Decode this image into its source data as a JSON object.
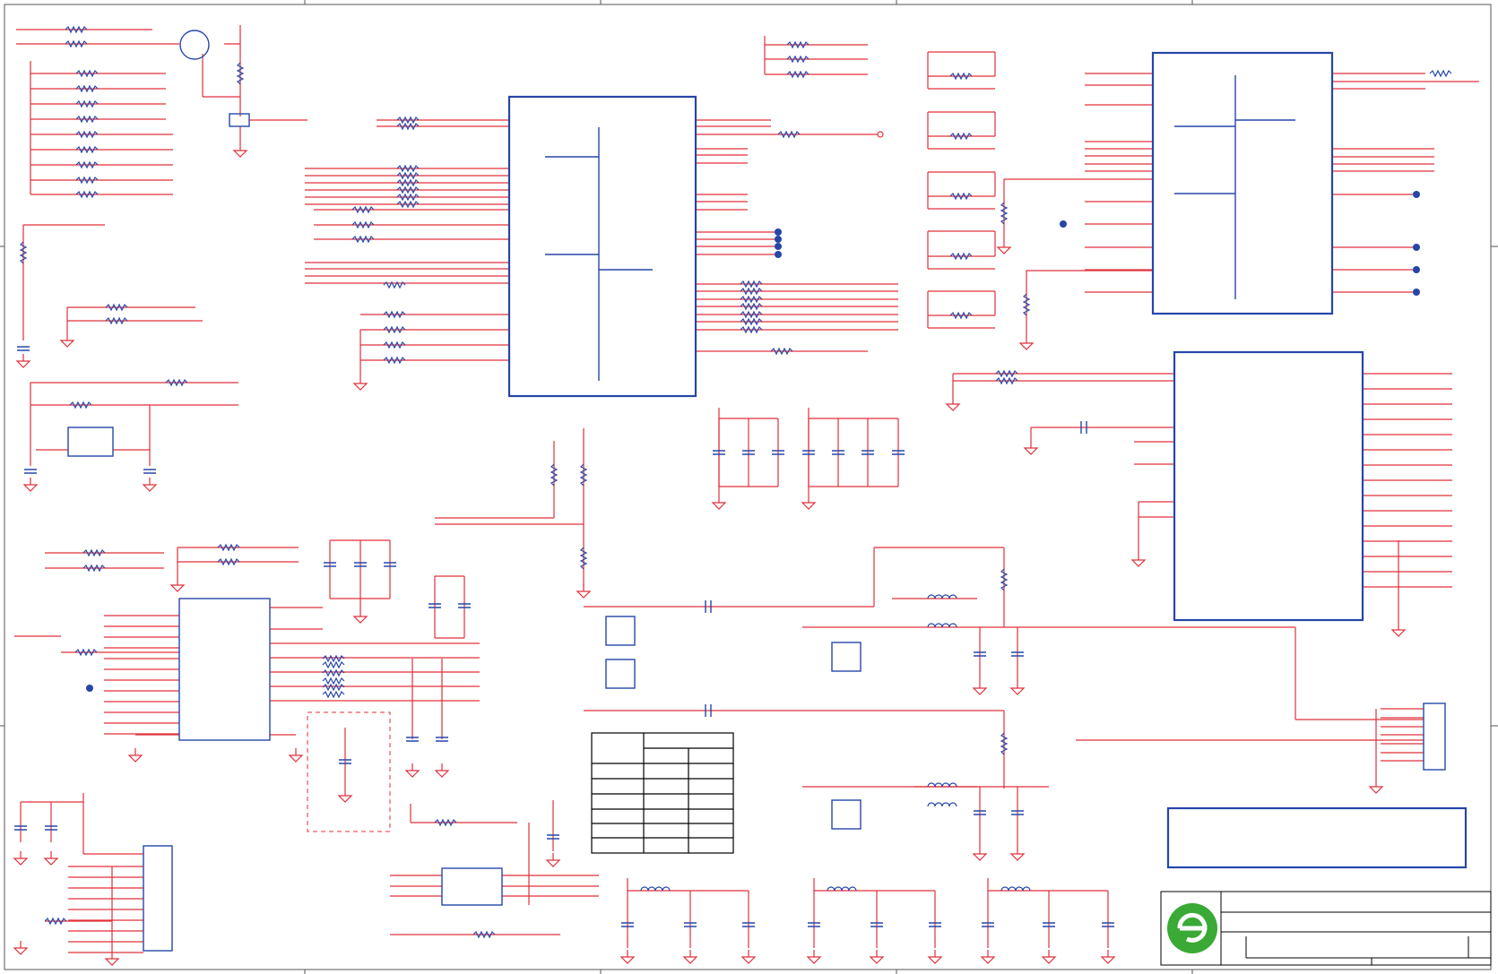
{
  "document": {
    "type": "electronic-schematic",
    "text_labels": [],
    "title_block": {
      "logo_icon": "circle-e-logo-icon",
      "logo_color": "#3aa935"
    }
  },
  "colors": {
    "wire": "#e0303a",
    "component": "#2646a8",
    "background": "#ffffff",
    "frame": "#555555",
    "junction": "#2646a8"
  },
  "components": {
    "main_ic": "ic-u1",
    "right_ic_top": "ic-u2",
    "right_ic_bottom": "ic-u3",
    "left_ic": "ic-u4",
    "connector_left": "header-j1",
    "connector_right": "header-j2",
    "keepout_box": "dashed-optional-region",
    "table": "grid-table"
  }
}
